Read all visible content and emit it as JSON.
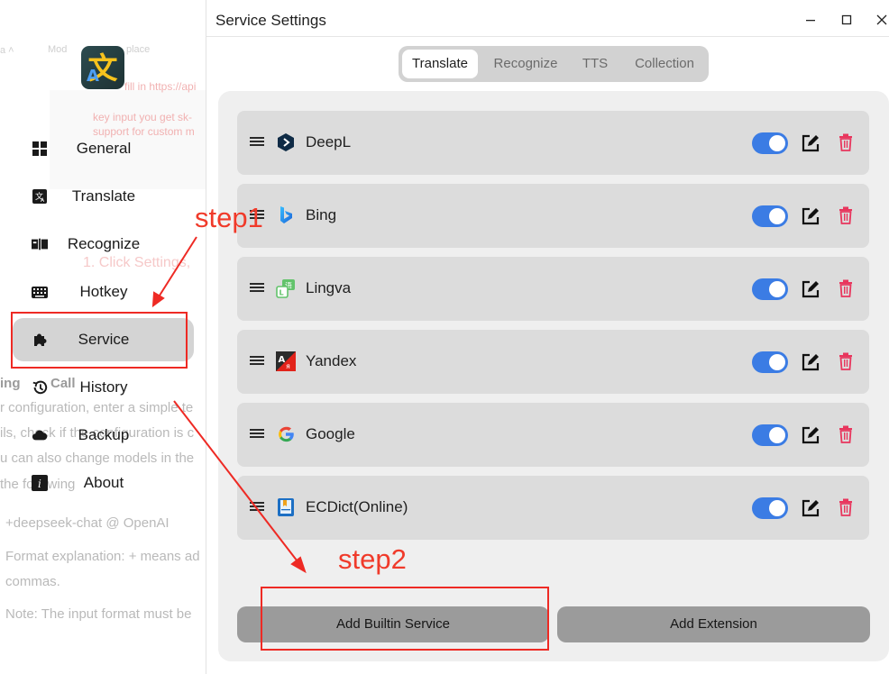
{
  "background_doc": {
    "frag_top": "Mod",
    "frag_top2": "place",
    "frag_url": "fill in https://api",
    "frag_key1": "key input you get sk-",
    "frag_key2": "support for custom m",
    "frag_step": "1. Click Settings,",
    "frag_heading": "ing",
    "frag_call": "Call",
    "frag_l1": "r configuration, enter a simple te",
    "frag_l2": "ils, check if the configuration is c",
    "frag_l3": "u can also change models in the",
    "frag_l4": "the following",
    "frag_model": "+deepseek-chat @ OpenAI",
    "frag_fmt": "Format explanation: + means ad",
    "frag_commas": "commas.",
    "frag_note": "Note: The input format must be"
  },
  "sidebar": {
    "items": [
      {
        "label": "General",
        "icon": "grid-icon"
      },
      {
        "label": "Translate",
        "icon": "translate-icon"
      },
      {
        "label": "Recognize",
        "icon": "recognize-icon"
      },
      {
        "label": "Hotkey",
        "icon": "keyboard-icon"
      },
      {
        "label": "Service",
        "icon": "puzzle-icon",
        "active": true
      },
      {
        "label": "History",
        "icon": "history-icon"
      },
      {
        "label": "Backup",
        "icon": "cloud-icon"
      },
      {
        "label": "About",
        "icon": "info-icon"
      }
    ]
  },
  "window": {
    "title": "Service Settings",
    "tabs": [
      {
        "label": "Translate",
        "active": true
      },
      {
        "label": "Recognize"
      },
      {
        "label": "TTS"
      },
      {
        "label": "Collection"
      }
    ],
    "services": [
      {
        "name": "DeepL",
        "icon": "deepl-icon",
        "enabled": true
      },
      {
        "name": "Bing",
        "icon": "bing-icon",
        "enabled": true
      },
      {
        "name": "Lingva",
        "icon": "lingva-icon",
        "enabled": true
      },
      {
        "name": "Yandex",
        "icon": "yandex-icon",
        "enabled": true
      },
      {
        "name": "Google",
        "icon": "google-icon",
        "enabled": true
      },
      {
        "name": "ECDict(Online)",
        "icon": "ecdict-icon",
        "enabled": true
      }
    ],
    "add_builtin_label": "Add Builtin Service",
    "add_extension_label": "Add Extension"
  },
  "annotations": {
    "step1": "step1",
    "step2": "step2",
    "color": "#f03a2a"
  },
  "colors": {
    "toggle_on": "#3b7ce4",
    "delete": "#e8365d",
    "active_nav": "#d4d4d4"
  }
}
